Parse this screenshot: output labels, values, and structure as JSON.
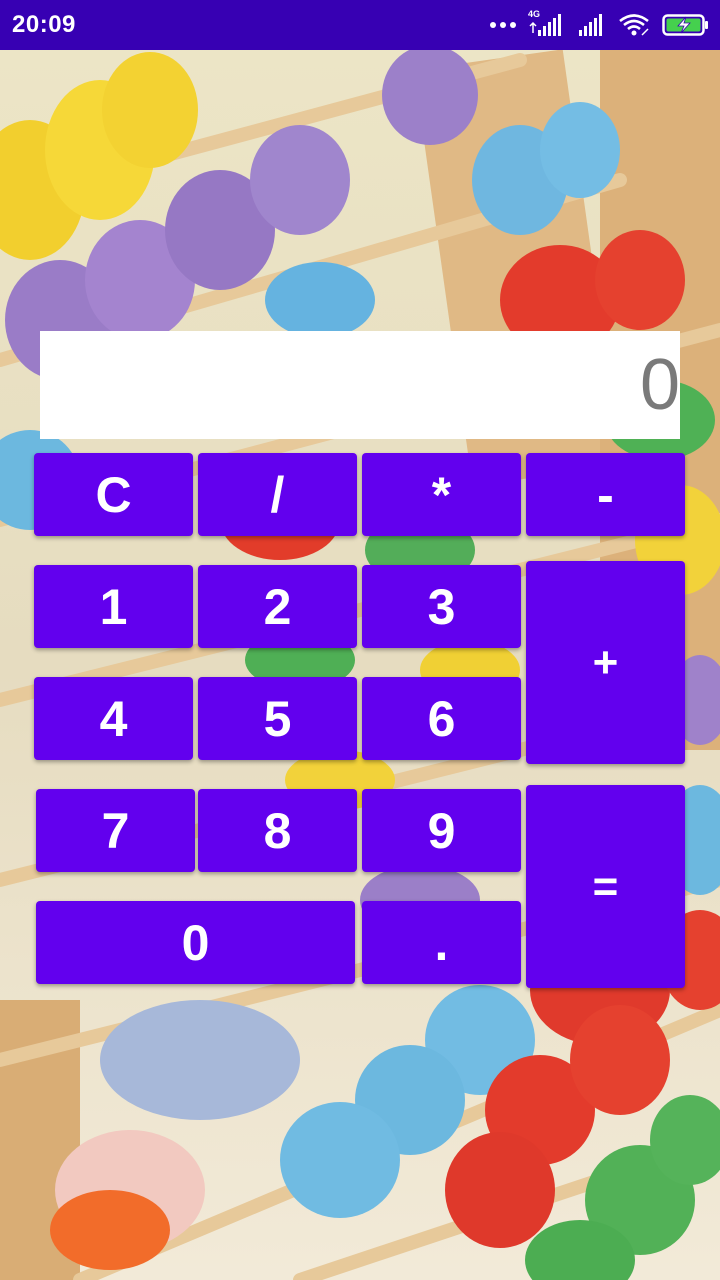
{
  "status_bar": {
    "time": "20:09",
    "network_label": "4G",
    "icons": [
      "more-dots-icon",
      "signal-4g-icon",
      "signal-icon",
      "wifi-icon",
      "battery-charging-icon"
    ]
  },
  "colors": {
    "status_bar": "#3700b3",
    "key": "#6200ee",
    "key_text": "#ffffff",
    "display_bg": "#ffffff",
    "display_text": "#7a7a7a"
  },
  "background_image": "abacus-photo",
  "display": {
    "value": "0"
  },
  "keys": {
    "clear": "C",
    "divide": "/",
    "multiply": "*",
    "subtract": "-",
    "one": "1",
    "two": "2",
    "three": "3",
    "add": "+",
    "four": "4",
    "five": "5",
    "six": "6",
    "seven": "7",
    "eight": "8",
    "nine": "9",
    "equals": "=",
    "zero": "0",
    "decimal": "."
  }
}
